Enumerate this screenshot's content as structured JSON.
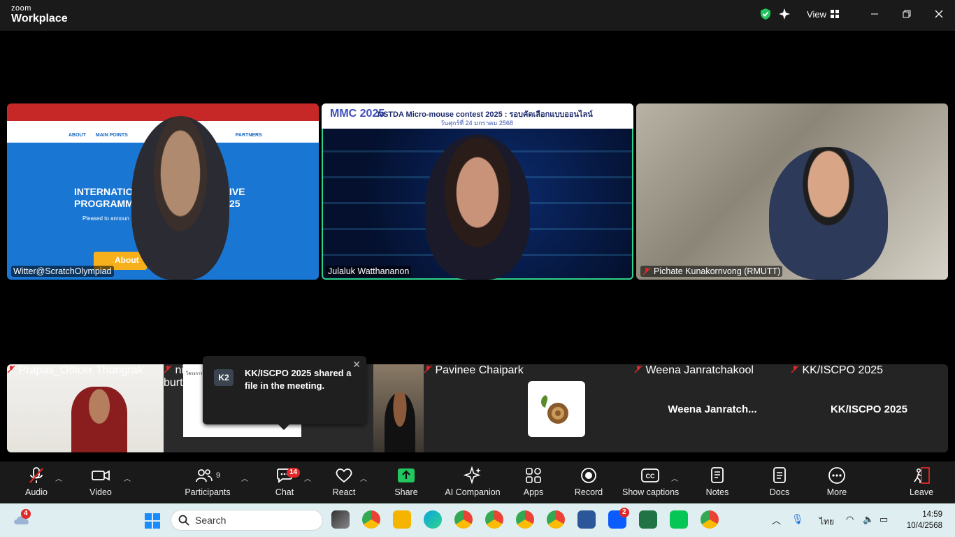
{
  "app": {
    "brand_top": "zoom",
    "brand_bottom": "Workplace",
    "view_label": "View"
  },
  "participants_main": [
    {
      "name": "Witter@ScratchOlympiad",
      "muted": false
    },
    {
      "name": "Julaluk Watthananon",
      "muted": false,
      "active_speaker": true
    },
    {
      "name": "Pichate Kunakornvong (RMUTT)",
      "muted": true
    }
  ],
  "shared_slide": {
    "title": "NSTDA Micro-mouse contest 2025 : รอบคัดเลือกแบบออนไลน์",
    "date": "วันศุกร์ที่ 24 มกราคม 2568",
    "logo": "MMC 2025"
  },
  "web_page": {
    "nav": [
      "ABOUT",
      "MAIN POINTS",
      "PARTNERS"
    ],
    "headline_1": "INTERNATIO",
    "headline_2": "PROGRAMMI",
    "year": "25",
    "suffix": "IVE",
    "about": "About",
    "body": "Pleased to announ"
  },
  "participants_strip": [
    {
      "name": "Prapas_Officer Thongrak",
      "muted": true
    },
    {
      "name": "nipat",
      "muted": true
    },
    {
      "name": "burt",
      "muted": false
    },
    {
      "name": "Pavinee Chaipark",
      "muted": true
    },
    {
      "name": "Weena Janratchakool",
      "display": "Weena  Janratch...",
      "muted": true
    },
    {
      "name": "KK/ISCPO 2025",
      "display": "KK/ISCPO 2025",
      "muted": true
    }
  ],
  "toast": {
    "avatar": "K2",
    "message": "KK/ISCPO 2025 shared a file in the meeting."
  },
  "toolbar": {
    "audio": "Audio",
    "video": "Video",
    "participants": "Participants",
    "participants_count": "9",
    "chat": "Chat",
    "chat_badge": "14",
    "react": "React",
    "share": "Share",
    "ai_companion": "AI Companion",
    "apps": "Apps",
    "record": "Record",
    "captions": "Show captions",
    "notes": "Notes",
    "docs": "Docs",
    "more": "More",
    "leave": "Leave"
  },
  "taskbar": {
    "weather_badge": "4",
    "search_placeholder": "Search",
    "zoom_badge": "2",
    "language": "ไทย",
    "time": "14:59",
    "date": "10/4/2568"
  },
  "colors": {
    "active_speaker": "#2fd38a",
    "share_green": "#22c55e",
    "leave_red": "#e02828",
    "badge_red": "#e02828"
  }
}
